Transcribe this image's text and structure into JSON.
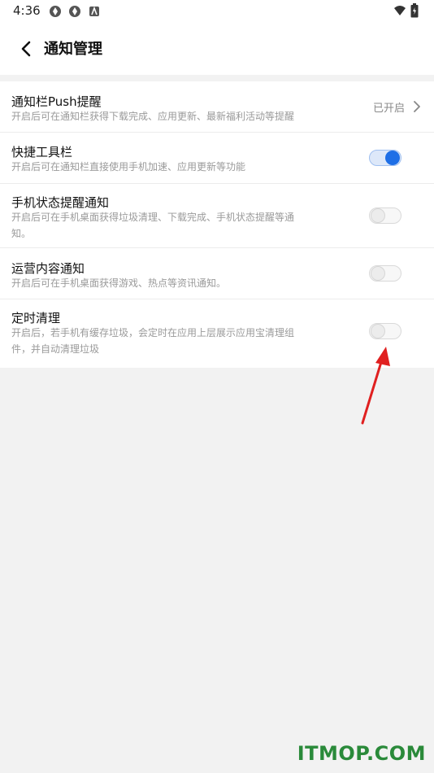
{
  "status_bar": {
    "time": "4:36"
  },
  "toolbar": {
    "title": "通知管理",
    "back_icon": "chevron-left-icon"
  },
  "settings": [
    {
      "title": "通知栏Push提醒",
      "description": "开启后可在通知栏获得下载完成、应用更新、最新福利活动等提醒",
      "value": "已开启",
      "type": "link"
    },
    {
      "title": "快捷工具栏",
      "description": "开启后可在通知栏直接使用手机加速、应用更新等功能",
      "enabled": true,
      "type": "toggle"
    },
    {
      "title": "手机状态提醒通知",
      "description_line1": "开启后可在手机桌面获得垃圾清理、下载完成、手机状态提醒等通",
      "description_line2": "知。",
      "enabled": false,
      "type": "toggle"
    },
    {
      "title": "运营内容通知",
      "description": "开启后可在手机桌面获得游戏、热点等资讯通知。",
      "enabled": false,
      "type": "toggle"
    },
    {
      "title": "定时清理",
      "description_line1": "开启后，若手机有缓存垃圾，会定时在应用上层展示应用宝清理组",
      "description_line2": "件，并自动清理垃圾",
      "enabled": false,
      "type": "toggle"
    }
  ],
  "watermark": "ITMOP.COM",
  "colors": {
    "accent": "#1e6fe6",
    "annotation_arrow": "#e02020",
    "watermark": "#2a8a3a"
  }
}
